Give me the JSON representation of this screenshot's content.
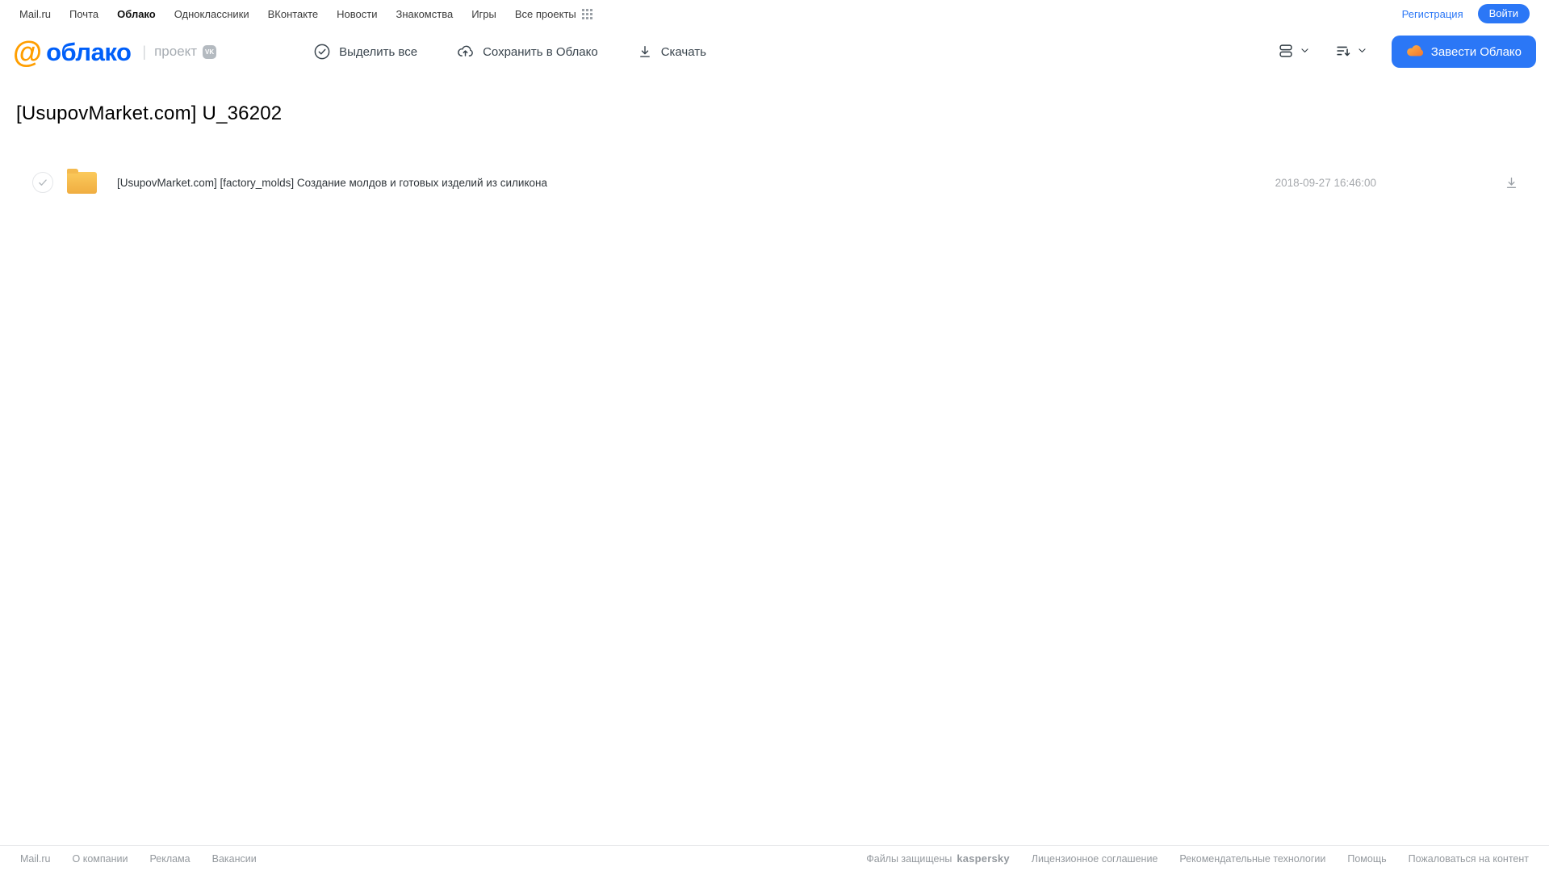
{
  "topnav": {
    "items": [
      "Mail.ru",
      "Почта",
      "Облако",
      "Одноклассники",
      "ВКонтакте",
      "Новости",
      "Знакомства",
      "Игры",
      "Все проекты"
    ],
    "registration_label": "Регистрация",
    "login_label": "Войти"
  },
  "header": {
    "logo_at": "@",
    "logo_text": "облако",
    "project_label": "проект",
    "vk_badge": "VK",
    "select_all_label": "Выделить все",
    "save_to_cloud_label": "Сохранить в Облако",
    "download_label": "Скачать",
    "get_cloud_label": "Завести Облако"
  },
  "main": {
    "title": "[UsupovMarket.com] U_36202",
    "file": {
      "name": "[UsupovMarket.com] [factory_molds] Создание молдов и готовых изделий из силикона",
      "date": "2018-09-27 16:46:00"
    }
  },
  "footer": {
    "links_left": [
      "Mail.ru",
      "О компании",
      "Реклама",
      "Вакансии"
    ],
    "protected_label": "Файлы защищены",
    "kaspersky_label": "kaspersky",
    "links_right": [
      "Лицензионное соглашение",
      "Рекомендательные технологии",
      "Помощь",
      "Пожаловаться на контент"
    ]
  },
  "colors": {
    "brand_blue": "#2b77f6",
    "logo_orange": "#ff9e00",
    "logo_blue": "#005ff9",
    "kaspersky_green": "#00a88e",
    "folder_yellow": "#f5bc4f",
    "toolbar_text": "#39444d",
    "muted_text": "#94999e"
  }
}
